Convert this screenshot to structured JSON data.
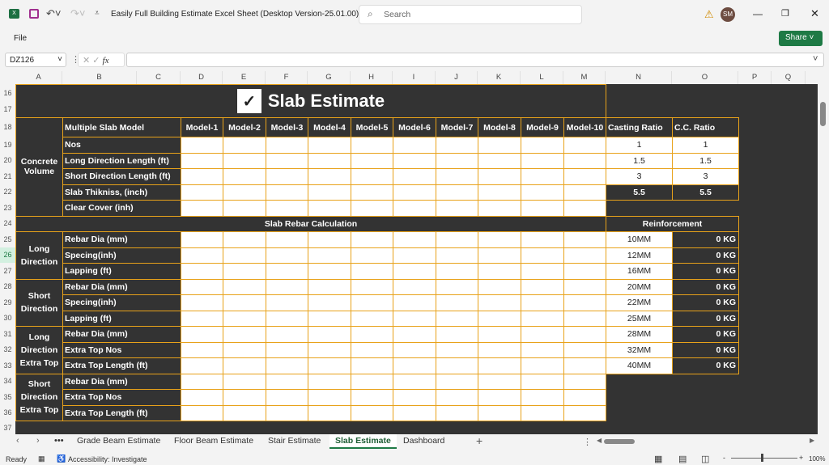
{
  "app": {
    "title": "Easily Full Building Estimate Excel Sheet (Desktop Version-25.01.00)  -  E...",
    "search_placeholder": "Search",
    "user_initials": "SM",
    "menu_file": "File",
    "share_label": "Share",
    "name_box": "DZ126",
    "fx": "fx",
    "accent": "#e8a21a",
    "dark": "#333333"
  },
  "columns": [
    "A",
    "B",
    "C",
    "D",
    "E",
    "F",
    "G",
    "H",
    "I",
    "J",
    "K",
    "L",
    "M",
    "N",
    "O",
    "P",
    "Q"
  ],
  "rows": [
    "16",
    "17",
    "18",
    "19",
    "20",
    "21",
    "22",
    "23",
    "24",
    "25",
    "26",
    "27",
    "28",
    "29",
    "30",
    "31",
    "32",
    "33",
    "34",
    "35",
    "36",
    "37"
  ],
  "sheet": {
    "title": "Slab Estimate",
    "checkbox": "✓",
    "concrete_group": "Concrete Volume",
    "model_header": "Multiple Slab Model",
    "models": [
      "Model-1",
      "Model-2",
      "Model-3",
      "Model-4",
      "Model-5",
      "Model-6",
      "Model-7",
      "Model-8",
      "Model-9",
      "Model-10"
    ],
    "concrete_rows": [
      "Nos",
      "Long Direction Length (ft)",
      "Short Direction Length (ft)",
      "Slab Thikniss, (inch)",
      "Clear Cover (inh)"
    ],
    "casting_ratio_header": "Casting Ratio",
    "cc_ratio_header": "C.C. Ratio",
    "casting_ratio": [
      "1",
      "1.5",
      "3",
      "5.5"
    ],
    "cc_ratio": [
      "1",
      "1.5",
      "3",
      "5.5"
    ],
    "rebar_header": "Slab Rebar Calculation",
    "reinforcement_header": "Reinforcement",
    "groups": [
      {
        "label": "Long Direction",
        "rows": [
          "Rebar Dia (mm)",
          "Specing(inh)",
          "Lapping (ft)"
        ]
      },
      {
        "label": "Short Direction",
        "rows": [
          "Rebar Dia (mm)",
          "Specing(inh)",
          "Lapping (ft)"
        ]
      },
      {
        "label": "Long Direction Extra Top",
        "rows": [
          "Rebar Dia (mm)",
          "Extra Top Nos",
          "Extra Top Length (ft)"
        ]
      },
      {
        "label": "Short Direction Extra Top",
        "rows": [
          "Rebar Dia (mm)",
          "Extra Top Nos",
          "Extra Top Length (ft)"
        ]
      }
    ],
    "reinforcement": [
      {
        "size": "10MM",
        "qty": "0 KG"
      },
      {
        "size": "12MM",
        "qty": "0 KG"
      },
      {
        "size": "16MM",
        "qty": "0 KG"
      },
      {
        "size": "20MM",
        "qty": "0 KG"
      },
      {
        "size": "22MM",
        "qty": "0 KG"
      },
      {
        "size": "25MM",
        "qty": "0 KG"
      },
      {
        "size": "28MM",
        "qty": "0 KG"
      },
      {
        "size": "32MM",
        "qty": "0 KG"
      },
      {
        "size": "40MM",
        "qty": "0 KG"
      }
    ]
  },
  "tabs": {
    "items": [
      "Grade Beam Estimate",
      "Floor Beam Estimate",
      "Stair Estimate",
      "Slab Estimate",
      "Dashboard"
    ],
    "active": "Slab Estimate",
    "more": "•••",
    "add": "+"
  },
  "status": {
    "ready": "Ready",
    "accessibility": "Accessibility: Investigate",
    "zoom": "100%"
  }
}
